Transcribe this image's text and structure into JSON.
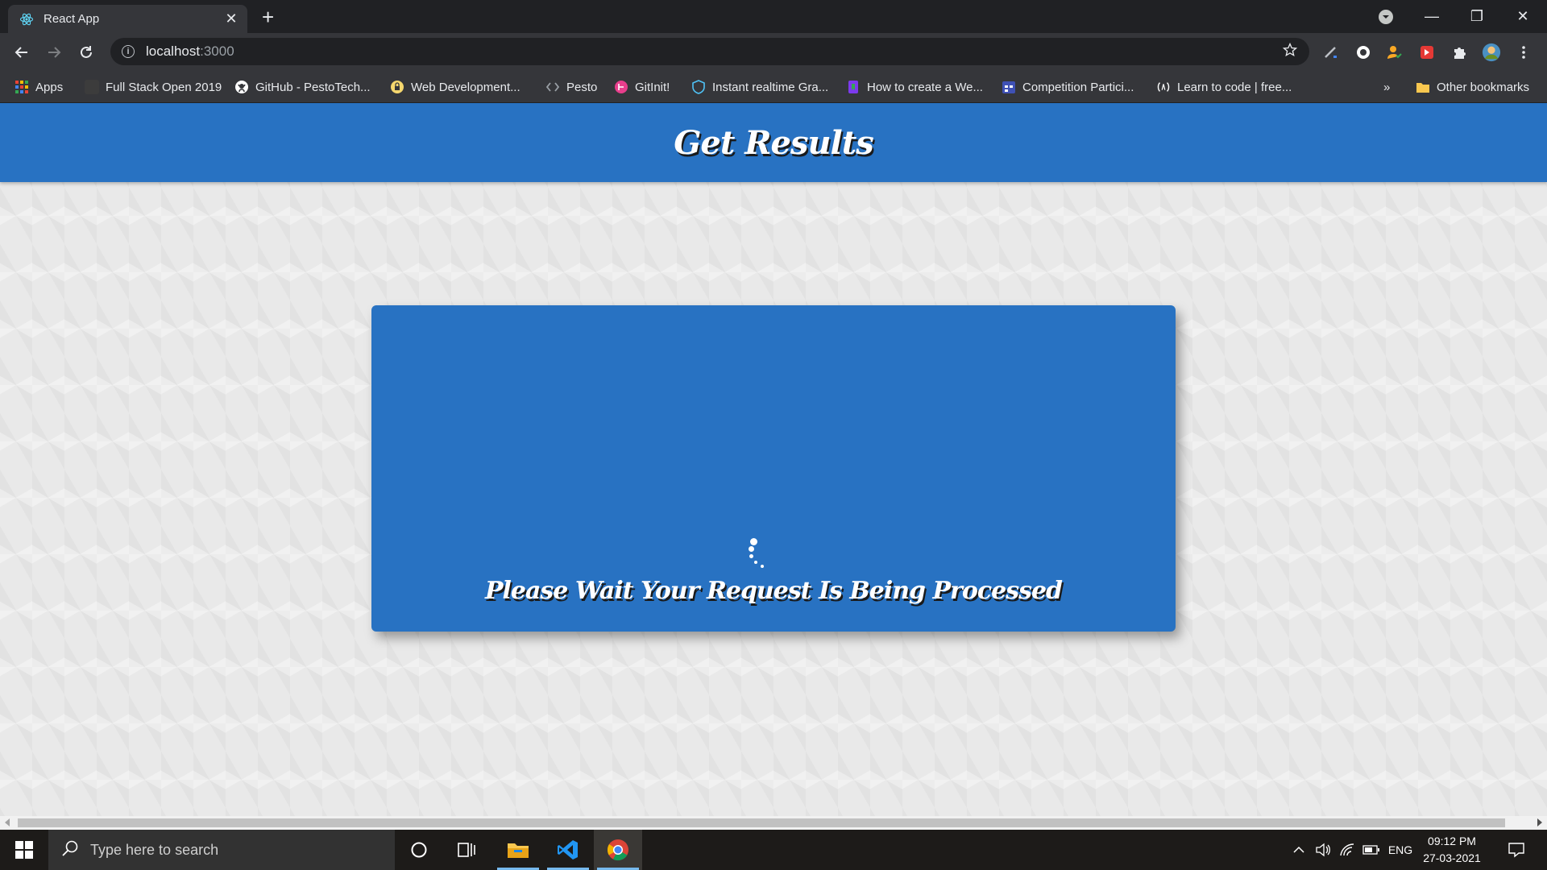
{
  "browser": {
    "tab_title": "React App",
    "url_host": "localhost",
    "url_port": ":3000",
    "bookmarks": [
      {
        "label": "Apps",
        "icon": "apps-grid-icon",
        "color": "#ea4335"
      },
      {
        "label": "Full Stack Open 2019",
        "icon": "blank-page-icon",
        "color": "#3c3c3c"
      },
      {
        "label": "GitHub - PestoTech...",
        "icon": "github-icon",
        "color": "#ffffff"
      },
      {
        "label": "Web Development...",
        "icon": "lock-badge-icon",
        "color": "#f5d76e"
      },
      {
        "label": "Pesto",
        "icon": "code-brackets-icon",
        "color": "#9aa0a6"
      },
      {
        "label": "GitInit!",
        "icon": "gitinit-icon",
        "color": "#e83e8c"
      },
      {
        "label": "Instant realtime Gra...",
        "icon": "shield-icon",
        "color": "#4fc3f7"
      },
      {
        "label": "How to create a We...",
        "icon": "bookmark-flag-icon",
        "color": "#7c3aed"
      },
      {
        "label": "Competition Partici...",
        "icon": "calendar-icon",
        "color": "#3f51b5"
      },
      {
        "label": "Learn to code | free...",
        "icon": "freecodecamp-icon",
        "color": "#ffffff"
      }
    ],
    "overflow_label": "»",
    "other_bookmarks": "Other bookmarks"
  },
  "page": {
    "header_title": "Get Results",
    "loading_message": "Please Wait Your Request Is Being Processed",
    "colors": {
      "primary": "#2872c2",
      "background": "#e9e9e9"
    }
  },
  "taskbar": {
    "search_placeholder": "Type here to search",
    "language": "ENG",
    "time": "09:12 PM",
    "date": "27-03-2021"
  }
}
